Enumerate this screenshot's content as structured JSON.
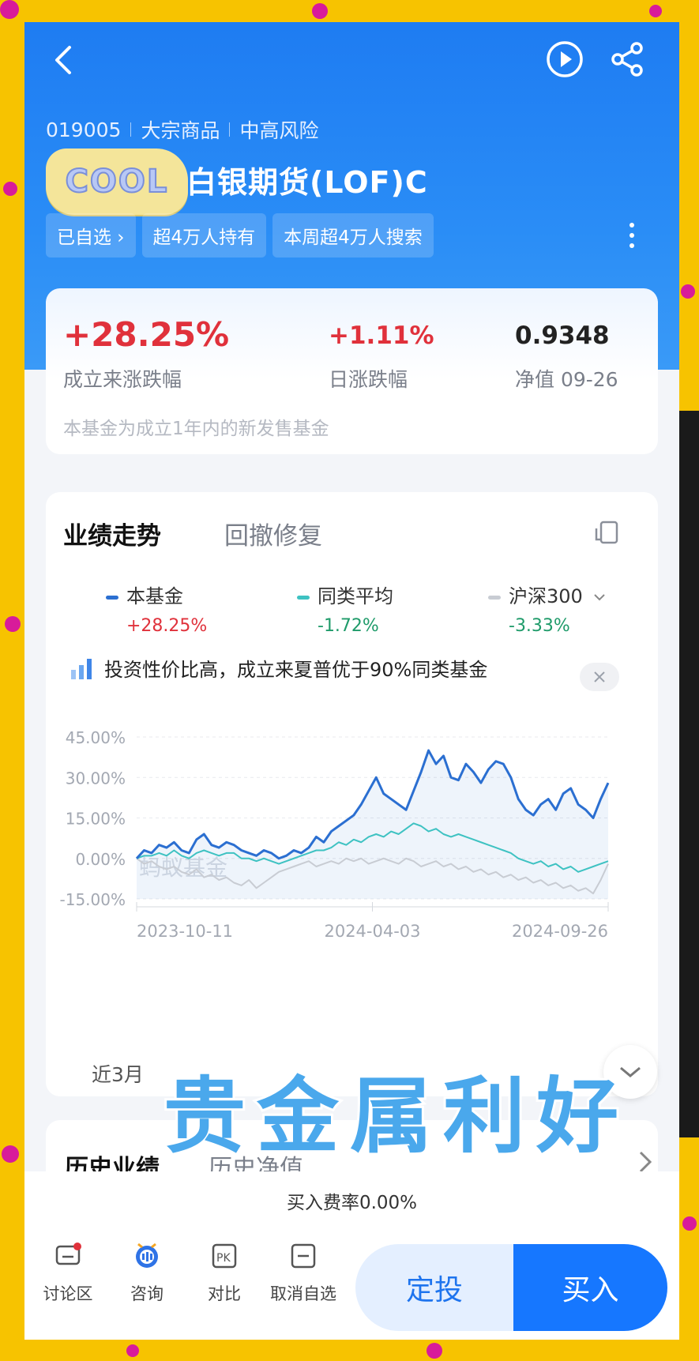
{
  "header": {
    "fund_code": "019005",
    "category": "大宗商品",
    "risk": "中高风险",
    "fund_name": "白银期货(LOF)C",
    "sticker_text": "COOL",
    "tags": [
      "已自选 ›",
      "超4万人持有",
      "本周超4万人搜索"
    ]
  },
  "summary": {
    "since_inception_value": "+28.25%",
    "since_inception_label": "成立来涨跌幅",
    "daily_value": "+1.11%",
    "daily_label": "日涨跌幅",
    "nav_value": "0.9348",
    "nav_label": "净值 09-26",
    "note": "本基金为成立1年内的新发售基金"
  },
  "performance": {
    "tab_active": "业绩走势",
    "tab_inactive": "回撤修复",
    "legend": [
      {
        "name": "本基金",
        "pct": "+28.25%",
        "color": "#2b6fd1",
        "pct_color": "#e0313b"
      },
      {
        "name": "同类平均",
        "pct": "-1.72%",
        "color": "#3ec2c2",
        "pct_color": "#1f9b6a"
      },
      {
        "name": "沪深300",
        "pct": "-3.33%",
        "color": "#c8ccd3",
        "pct_color": "#1f9b6a"
      }
    ],
    "insight": "投资性价比高，成立来夏普优于90%同类基金",
    "watermark": "蚂蚁基金",
    "range_label": "近3月"
  },
  "chart_data": {
    "type": "line",
    "y_ticks": [
      "45.00%",
      "30.00%",
      "15.00%",
      "0.00%",
      "-15.00%"
    ],
    "x_ticks": [
      "2023-10-11",
      "2024-04-03",
      "2024-09-26"
    ],
    "ylim": [
      -15,
      45
    ],
    "series": [
      {
        "name": "本基金",
        "color": "#2b6fd1",
        "values": [
          0,
          3,
          2,
          5,
          4,
          6,
          3,
          2,
          7,
          9,
          5,
          4,
          6,
          5,
          3,
          2,
          1,
          3,
          2,
          0,
          1,
          3,
          2,
          4,
          8,
          6,
          10,
          12,
          14,
          16,
          20,
          25,
          30,
          24,
          22,
          20,
          18,
          25,
          32,
          40,
          35,
          38,
          30,
          29,
          35,
          32,
          28,
          33,
          36,
          35,
          30,
          22,
          18,
          16,
          20,
          22,
          18,
          24,
          26,
          20,
          18,
          15,
          22,
          28
        ]
      },
      {
        "name": "同类平均",
        "color": "#3ec2c2",
        "values": [
          0,
          1,
          1,
          2,
          1,
          3,
          1,
          0,
          2,
          3,
          2,
          1,
          2,
          2,
          0,
          0,
          -1,
          0,
          -1,
          -2,
          -1,
          0,
          1,
          2,
          3,
          3,
          4,
          6,
          5,
          7,
          6,
          8,
          9,
          8,
          10,
          9,
          11,
          13,
          12,
          10,
          11,
          9,
          8,
          9,
          8,
          7,
          6,
          5,
          4,
          3,
          2,
          0,
          -1,
          -2,
          -1,
          -3,
          -2,
          -4,
          -3,
          -5,
          -4,
          -3,
          -2,
          -1
        ]
      },
      {
        "name": "沪深300",
        "color": "#c8ccd3",
        "values": [
          0,
          -2,
          -1,
          -3,
          -4,
          -3,
          -5,
          -6,
          -4,
          -7,
          -6,
          -8,
          -7,
          -9,
          -10,
          -8,
          -11,
          -9,
          -7,
          -5,
          -4,
          -3,
          -2,
          -1,
          -3,
          -2,
          -1,
          -2,
          0,
          -1,
          0,
          -2,
          -1,
          0,
          -1,
          -2,
          0,
          -1,
          -3,
          -2,
          -1,
          -3,
          -2,
          -4,
          -3,
          -5,
          -4,
          -6,
          -5,
          -7,
          -6,
          -8,
          -7,
          -9,
          -8,
          -10,
          -9,
          -11,
          -10,
          -12,
          -11,
          -13,
          -8,
          -2
        ]
      }
    ]
  },
  "history": {
    "tab_active": "历史业绩",
    "tab_inactive": "历史净值"
  },
  "overlay": {
    "caption": "贵金属利好"
  },
  "bottom": {
    "fee": "买入费率0.00%",
    "nav": [
      "讨论区",
      "咨询",
      "对比",
      "取消自选"
    ],
    "dingtou": "定投",
    "buy": "买入"
  }
}
